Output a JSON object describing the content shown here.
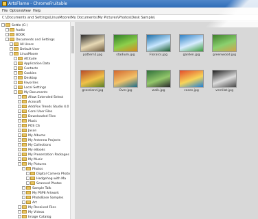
{
  "window": {
    "title": "ArtsFlame - ChromeFruitable"
  },
  "menu": [
    "File",
    "Options",
    "View",
    "Help"
  ],
  "path": "C:\\Documents and Settings\\LinusMoore\\My Documents\\My Pictures\\Photos\\Desk Sample\\",
  "tree": [
    {
      "label": "Settle (C:)",
      "indent": 0
    },
    {
      "label": "Audio",
      "indent": 1
    },
    {
      "label": "BOOK",
      "indent": 1
    },
    {
      "label": "Documents and Settings",
      "indent": 1
    },
    {
      "label": "All Users",
      "indent": 2
    },
    {
      "label": "Default User",
      "indent": 2
    },
    {
      "label": "LinusMoore",
      "indent": 2
    },
    {
      "label": "Attitude",
      "indent": 3
    },
    {
      "label": "Application Data",
      "indent": 3
    },
    {
      "label": "Contacts",
      "indent": 3
    },
    {
      "label": "Cookies",
      "indent": 3
    },
    {
      "label": "Desktop",
      "indent": 3
    },
    {
      "label": "Favorites",
      "indent": 3
    },
    {
      "label": "Local Settings",
      "indent": 3
    },
    {
      "label": "My Documents",
      "indent": 3
    },
    {
      "label": "Allow Extended Select",
      "indent": 4
    },
    {
      "label": "Acrosoft",
      "indent": 4
    },
    {
      "label": "Add/Fax Trends Studio 4.0",
      "indent": 4
    },
    {
      "label": "Corel User Files",
      "indent": 4
    },
    {
      "label": "Downloaded Files",
      "indent": 4
    },
    {
      "label": "Music",
      "indent": 4
    },
    {
      "label": "POS CS",
      "indent": 4
    },
    {
      "label": "Jason",
      "indent": 4
    },
    {
      "label": "My Albums",
      "indent": 4
    },
    {
      "label": "My Antenna Projects",
      "indent": 4
    },
    {
      "label": "My Collections",
      "indent": 4
    },
    {
      "label": "My eBooks",
      "indent": 4
    },
    {
      "label": "My Presentation Packages",
      "indent": 4
    },
    {
      "label": "My Music",
      "indent": 4
    },
    {
      "label": "My Pictures",
      "indent": 4
    },
    {
      "label": "Photos",
      "indent": 5
    },
    {
      "label": "Digital Camera Photos",
      "indent": 6
    },
    {
      "label": "Hedgehog with Ma",
      "indent": 6
    },
    {
      "label": "Scanned Photos",
      "indent": 6
    },
    {
      "label": "Sample Talk",
      "indent": 5
    },
    {
      "label": "My PSP8 Artwork",
      "indent": 5
    },
    {
      "label": "PhotoBase Samples",
      "indent": 5
    },
    {
      "label": "Art",
      "indent": 5
    },
    {
      "label": "My Received Files",
      "indent": 4
    },
    {
      "label": "My Videos",
      "indent": 4
    },
    {
      "label": "Image Catalog",
      "indent": 4
    }
  ],
  "thumbnails": [
    {
      "caption": "pattern1.jpg",
      "colors": [
        "#2a2a2a",
        "#e7d9b5",
        "#6f5b3f"
      ]
    },
    {
      "caption": "stadium.jpg",
      "colors": [
        "#2f7d28",
        "#8ccf4b",
        "#d98a1f"
      ]
    },
    {
      "caption": "Floraics.jpg",
      "colors": [
        "#1a6da8",
        "#c8e7ff",
        "#1d5e2f"
      ]
    },
    {
      "caption": "garden.jpg",
      "colors": [
        "#2c7fc4",
        "#d6ecff",
        "#3a9a3a"
      ]
    },
    {
      "caption": "greenwood.jpg",
      "colors": [
        "#3e7f2a",
        "#8ad06e",
        "#d1a44a"
      ]
    },
    {
      "caption": "grassland.jpg",
      "colors": [
        "#b74b28",
        "#f0c24a",
        "#5a7f2a"
      ]
    },
    {
      "caption": "Over.jpg",
      "colors": [
        "#d2672f",
        "#f2c36a",
        "#1f6d8a"
      ]
    },
    {
      "caption": "walk.jpg",
      "colors": [
        "#2f6f3a",
        "#93c76b",
        "#2b2b2b"
      ]
    },
    {
      "caption": "cases.jpg",
      "colors": [
        "#e34c2b",
        "#f7d55a",
        "#1f7fd6"
      ]
    },
    {
      "caption": "ventilat.jpg",
      "colors": [
        "#1e1e1e",
        "#dcdcdc",
        "#4a4a4a"
      ]
    }
  ]
}
